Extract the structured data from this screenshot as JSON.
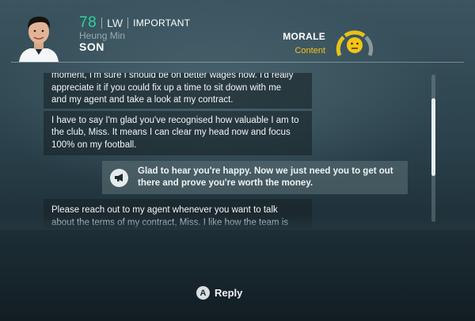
{
  "player": {
    "rating": "78",
    "position": "LW",
    "status": "IMPORTANT",
    "first_name": "Heung Min",
    "last_name": "SON"
  },
  "morale": {
    "title": "MORALE",
    "value": "Content",
    "level_fraction": 0.55,
    "colors": {
      "low": "#e8c21a",
      "mid": "#e8c21a",
      "high": "#9aa5a9",
      "face": "#f3c319"
    }
  },
  "conversation": [
    {
      "speaker": "player",
      "text": "moment, I'm sure I should be on better wages now. I'd really\nappreciate it if you could fix up a time to sit down with me\nand my agent and take a look at my contract."
    },
    {
      "speaker": "player",
      "text": "I have to say I'm glad you've recognised how valuable I am to\nthe club, Miss. It means I can clear my head now and focus\n100% on my football."
    },
    {
      "speaker": "manager",
      "icon": "megaphone-icon",
      "text": "Glad to hear you're happy. Now we just need you to get out\nthere and prove you're worth the money."
    },
    {
      "speaker": "player",
      "text": "Please reach out to my agent whenever you want to talk\nabout the terms of my contract, Miss. I like how the team is\nshaping up and I'd love to stay here for the long term"
    }
  ],
  "reply": {
    "button": "A",
    "label": "Reply"
  },
  "colors": {
    "accent_green": "#2bd4a0",
    "accent_yellow": "#f3c319"
  }
}
